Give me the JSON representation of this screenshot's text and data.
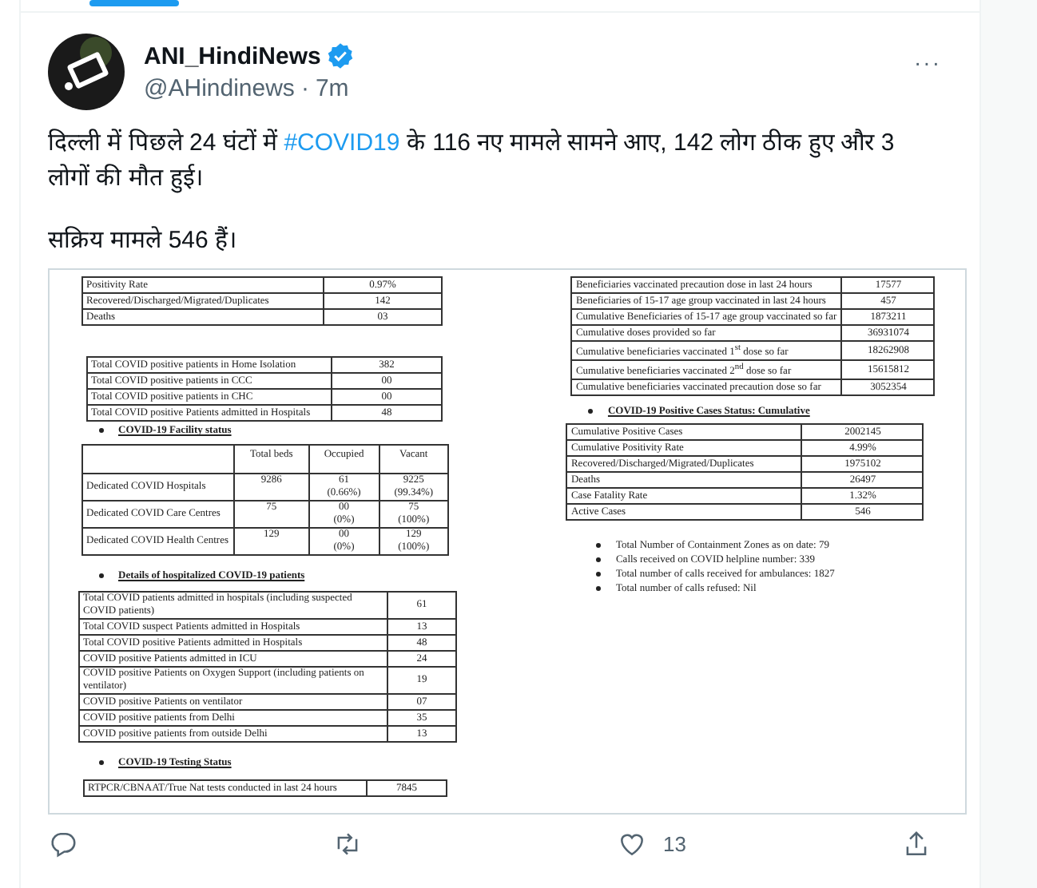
{
  "tweet": {
    "author": {
      "name": "ANI_HindiNews",
      "verified": true,
      "handle": "@AHindinews",
      "separator": "·",
      "time": "7m"
    },
    "more": "···",
    "paragraphs": [
      [
        {
          "kind": "plain",
          "text": "दिल्ली में पिछले 24 घंटों में "
        },
        {
          "kind": "hashtag",
          "text": "#COVID19"
        },
        {
          "kind": "plain",
          "text": " के 116 नए मामले सामने आए, 142 लोग ठीक हुए और 3 लोगों की मौत हुई।"
        }
      ],
      [
        {
          "kind": "plain",
          "text": "सक्रिय मामले 546 हैं।"
        }
      ]
    ],
    "document": {
      "left": [
        {
          "kind": "table",
          "rows": [
            [
              "Positivity Rate",
              "0.97%"
            ],
            [
              "Recovered/Discharged/Migrated/Duplicates",
              "142"
            ],
            [
              "Deaths",
              "03"
            ]
          ]
        },
        {
          "kind": "table",
          "rows": [
            [
              "Total COVID positive patients in Home Isolation",
              "382"
            ],
            [
              "Total COVID positive patients in CCC",
              "00"
            ],
            [
              "Total COVID positive patients in CHC",
              "00"
            ],
            [
              "Total COVID positive Patients admitted in Hospitals",
              "48"
            ]
          ]
        },
        {
          "kind": "heading",
          "text": "COVID-19 Facility status"
        },
        {
          "kind": "grid",
          "header": [
            "Total beds",
            "Occupied",
            "Vacant"
          ],
          "rows": [
            [
              "Dedicated COVID Hospitals",
              "9286",
              "61\n(0.66%)",
              "9225\n(99.34%)"
            ],
            [
              "Dedicated COVID Care Centres",
              "75",
              "00\n(0%)",
              "75\n(100%)"
            ],
            [
              "Dedicated COVID Health Centres",
              "129",
              "00\n(0%)",
              "129\n(100%)"
            ]
          ]
        },
        {
          "kind": "heading",
          "text": "Details of hospitalized COVID-19 patients"
        },
        {
          "kind": "table",
          "rows": [
            [
              "Total COVID patients admitted in hospitals (including suspected COVID patients)",
              "61"
            ],
            [
              "Total COVID suspect Patients admitted in Hospitals",
              "13"
            ],
            [
              "Total COVID positive Patients admitted in Hospitals",
              "48"
            ],
            [
              "COVID positive Patients admitted in ICU",
              "24"
            ],
            [
              "COVID positive Patients on Oxygen Support (including patients on ventilator)",
              "19"
            ],
            [
              "COVID positive Patients on ventilator",
              "07"
            ],
            [
              "COVID positive patients from Delhi",
              "35"
            ],
            [
              "COVID positive patients from outside Delhi",
              "13"
            ]
          ]
        },
        {
          "kind": "heading",
          "text": "COVID-19 Testing Status"
        },
        {
          "kind": "table",
          "rows": [
            [
              "RTPCR/CBNAAT/True Nat tests conducted in last 24 hours",
              "7845"
            ]
          ]
        }
      ],
      "right": [
        {
          "kind": "table",
          "rows": [
            [
              "Beneficiaries vaccinated precaution dose in last 24 hours",
              "17577"
            ],
            [
              "Beneficiaries of 15-17 age group vaccinated in last 24 hours",
              "457"
            ],
            [
              "Cumulative Beneficiaries of 15-17 age group vaccinated so far",
              "1873211"
            ],
            [
              "Cumulative doses provided so far",
              "36931074"
            ],
            [
              "Cumulative beneficiaries vaccinated 1$^{st}$ dose so far",
              "18262908"
            ],
            [
              "Cumulative beneficiaries vaccinated 2$^{nd}$ dose so far",
              "15615812"
            ],
            [
              "Cumulative beneficiaries vaccinated precaution dose so far",
              "3052354"
            ]
          ]
        },
        {
          "kind": "heading",
          "text": "COVID-19 Positive Cases Status: Cumulative"
        },
        {
          "kind": "table",
          "rows": [
            [
              "Cumulative Positive Cases",
              "2002145"
            ],
            [
              "Cumulative Positivity Rate",
              "4.99%"
            ],
            [
              "Recovered/Discharged/Migrated/Duplicates",
              "1975102"
            ],
            [
              "Deaths",
              "26497"
            ],
            [
              "Case Fatality Rate",
              "1.32%"
            ],
            [
              "Active Cases",
              "546"
            ]
          ]
        },
        {
          "kind": "bullets",
          "items": [
            "Total Number of Containment Zones as on date: 79",
            "Calls received on COVID helpline number: 339",
            "Total number of calls received for ambulances: 1827",
            "Total number of calls refused: Nil"
          ]
        }
      ]
    },
    "actions": [
      {
        "kind": "reply"
      },
      {
        "kind": "retweet"
      },
      {
        "kind": "like",
        "count": "13"
      },
      {
        "kind": "share"
      }
    ]
  }
}
